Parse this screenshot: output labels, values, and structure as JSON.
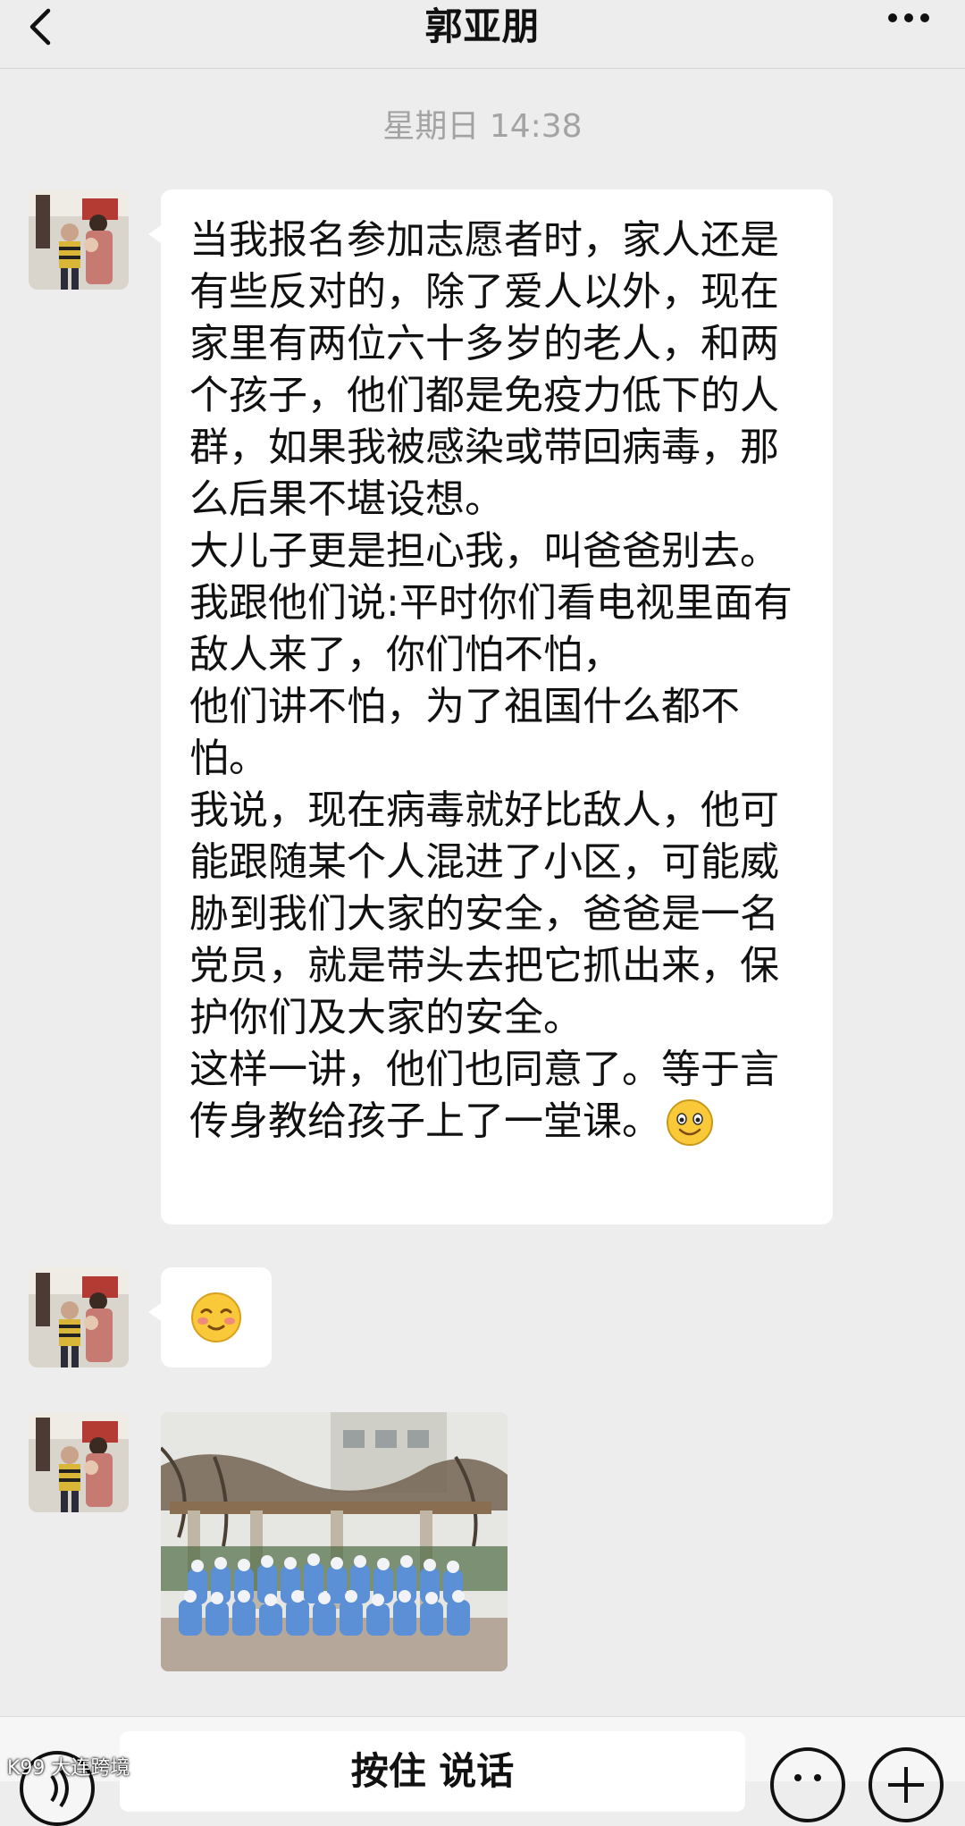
{
  "header": {
    "title": "郭亚朋",
    "back_icon": "chevron-left-icon",
    "more_icon": "more-dots-icon"
  },
  "timestamp": "星期日 14:38",
  "messages": [
    {
      "type": "text",
      "text": "当我报名参加志愿者时，家人还是有些反对的，除了爱人以外，现在家里有两位六十多岁的老人，和两个孩子，他们都是免疫力低下的人群，如果我被感染或带回病毒，那么后果不堪设想。\n大儿子更是担心我，叫爸爸别去。\n我跟他们说:平时你们看电视里面有敌人来了，你们怕不怕，\n他们讲不怕，为了祖国什么都不怕。\n我说，现在病毒就好比敌人，他可能跟随某个人混进了小区，可能威胁到我们大家的安全，爸爸是一名党员，就是带头去把它抓出来，保护你们及大家的安全。\n这样一讲，他们也同意了。等于言传身教给孩子上了一堂课。",
      "trailing_emoji": "smile-emoji"
    },
    {
      "type": "emoji",
      "emoji": "blushing-smile-emoji"
    },
    {
      "type": "image",
      "description_icon": "group-photo-image"
    }
  ],
  "input_bar": {
    "hold_to_talk_label": "按住 说话",
    "voice_icon": "voice-icon",
    "emoji_icon": "emoji-icon",
    "plus_icon": "plus-icon"
  },
  "watermark": "K99 大连跨境"
}
